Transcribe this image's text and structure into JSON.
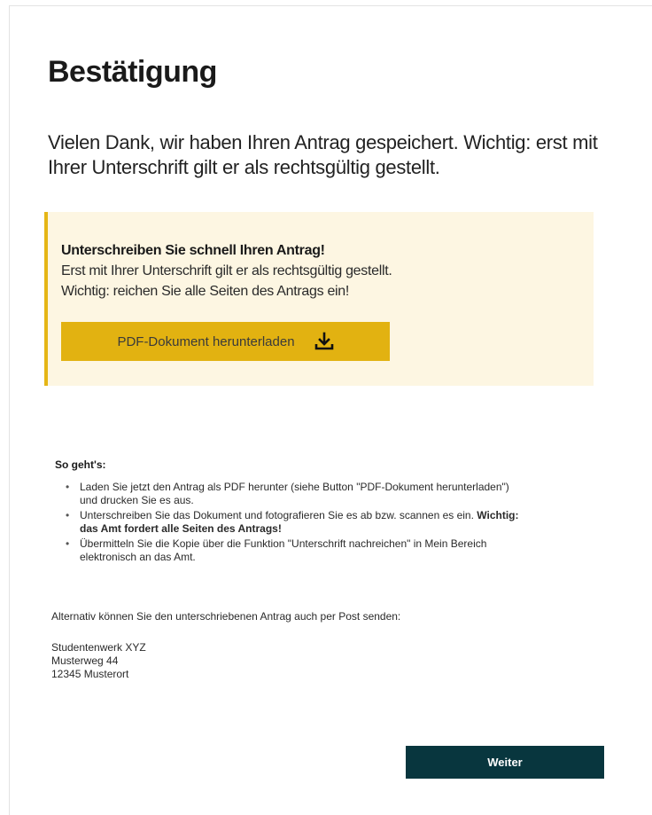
{
  "page": {
    "title": "Bestätigung",
    "intro": "Vielen Dank, wir haben Ihren Antrag gespeichert. Wichtig: erst mit Ihrer Unterschrift gilt er als rechtsgültig gestellt."
  },
  "notice": {
    "heading": "Unterschreiben Sie schnell Ihren Antrag!",
    "line1": "Erst mit Ihrer Unterschrift gilt er als rechtsgültig gestellt.",
    "line2": "Wichtig: reichen Sie alle Seiten des Antrags ein!",
    "download_label": "PDF-Dokument herunterladen",
    "download_icon": "download-icon",
    "accent_color": "#e5b616",
    "background_color": "#fdf6e2"
  },
  "howto": {
    "title": "So geht's:",
    "steps": [
      {
        "text": "Laden Sie jetzt den Antrag als PDF herunter (siehe Button \"PDF-Dokument herunterladen\") und drucken Sie es aus."
      },
      {
        "text_before": "Unterschreiben Sie das Dokument und fotografieren Sie es ab bzw. scannen es ein.",
        "text_bold": "Wichtig: das Amt fordert alle Seiten des Antrags!"
      },
      {
        "text": "Übermitteln Sie die Kopie über die Funktion \"Unterschrift nachreichen\" in Mein Bereich elektronisch an das Amt."
      }
    ]
  },
  "alternative": {
    "text": "Alternativ können Sie den unterschriebenen Antrag auch per Post senden:"
  },
  "address": {
    "name": "Studentenwerk XYZ",
    "street": "Musterweg 44",
    "city": "12345 Musterort"
  },
  "footer": {
    "next_label": "Weiter",
    "next_color": "#08363e"
  }
}
